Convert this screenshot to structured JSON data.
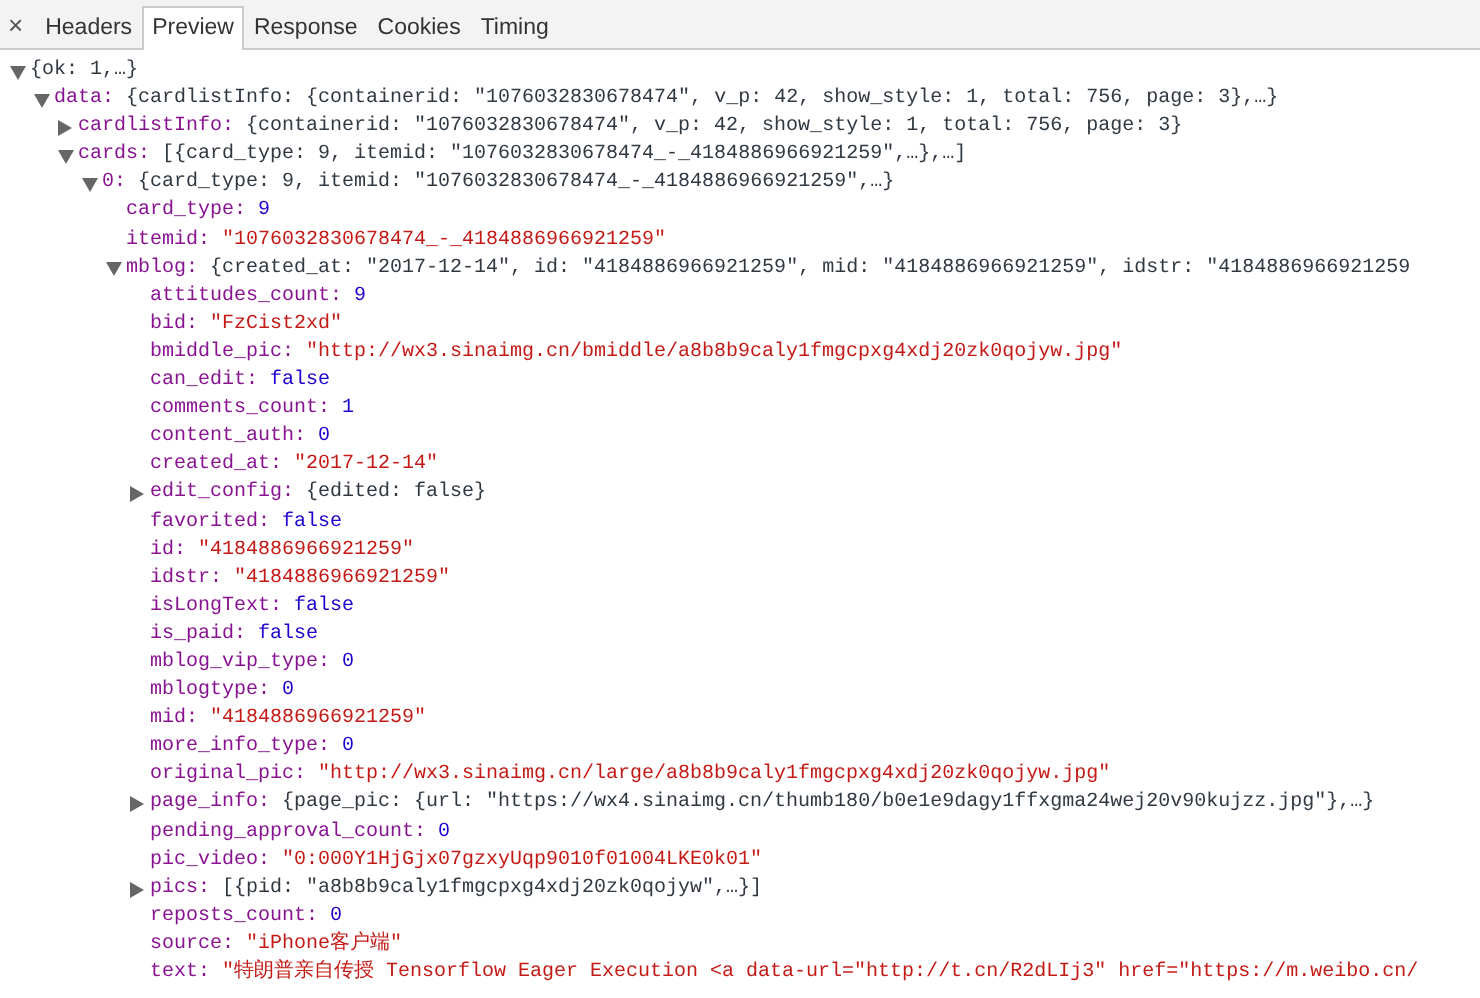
{
  "close_label": "×",
  "tabs": [
    {
      "label": "Headers",
      "selected": false
    },
    {
      "label": "Preview",
      "selected": true
    },
    {
      "label": "Response",
      "selected": false
    },
    {
      "label": "Cookies",
      "selected": false
    },
    {
      "label": "Timing",
      "selected": false
    }
  ],
  "tree": [
    {
      "value": "{ok: 1,…}",
      "kind": "preview",
      "expanded": true,
      "children": [
        {
          "key": "data:",
          "value": "{cardlistInfo: {containerid: \"1076032830678474\", v_p: 42, show_style: 1, total: 756, page: 3},…}",
          "kind": "preview",
          "expanded": true,
          "children": [
            {
              "key": "cardlistInfo:",
              "value": "{containerid: \"1076032830678474\", v_p: 42, show_style: 1, total: 756, page: 3}",
              "kind": "preview",
              "expanded": false
            },
            {
              "key": "cards:",
              "value": "[{card_type: 9, itemid: \"1076032830678474_-_4184886966921259\",…},…]",
              "kind": "preview",
              "expanded": true,
              "children": [
                {
                  "key": "0:",
                  "value": "{card_type: 9, itemid: \"1076032830678474_-_4184886966921259\",…}",
                  "kind": "preview",
                  "expanded": true,
                  "children": [
                    {
                      "key": "card_type:",
                      "value": "9",
                      "kind": "number"
                    },
                    {
                      "key": "itemid:",
                      "value": "\"1076032830678474_-_4184886966921259\"",
                      "kind": "string"
                    },
                    {
                      "key": "mblog:",
                      "value": "{created_at: \"2017-12-14\", id: \"4184886966921259\", mid: \"4184886966921259\", idstr: \"4184886966921259",
                      "kind": "preview",
                      "expanded": true,
                      "children": [
                        {
                          "key": "attitudes_count:",
                          "value": "9",
                          "kind": "number"
                        },
                        {
                          "key": "bid:",
                          "value": "\"FzCist2xd\"",
                          "kind": "string"
                        },
                        {
                          "key": "bmiddle_pic:",
                          "value": "\"http://wx3.sinaimg.cn/bmiddle/a8b8b9caly1fmgcpxg4xdj20zk0qojyw.jpg\"",
                          "kind": "string"
                        },
                        {
                          "key": "can_edit:",
                          "value": "false",
                          "kind": "boolean"
                        },
                        {
                          "key": "comments_count:",
                          "value": "1",
                          "kind": "number"
                        },
                        {
                          "key": "content_auth:",
                          "value": "0",
                          "kind": "number"
                        },
                        {
                          "key": "created_at:",
                          "value": "\"2017-12-14\"",
                          "kind": "string"
                        },
                        {
                          "key": "edit_config:",
                          "value": "{edited: false}",
                          "kind": "preview",
                          "expanded": false
                        },
                        {
                          "key": "favorited:",
                          "value": "false",
                          "kind": "boolean"
                        },
                        {
                          "key": "id:",
                          "value": "\"4184886966921259\"",
                          "kind": "string"
                        },
                        {
                          "key": "idstr:",
                          "value": "\"4184886966921259\"",
                          "kind": "string"
                        },
                        {
                          "key": "isLongText:",
                          "value": "false",
                          "kind": "boolean"
                        },
                        {
                          "key": "is_paid:",
                          "value": "false",
                          "kind": "boolean"
                        },
                        {
                          "key": "mblog_vip_type:",
                          "value": "0",
                          "kind": "number"
                        },
                        {
                          "key": "mblogtype:",
                          "value": "0",
                          "kind": "number"
                        },
                        {
                          "key": "mid:",
                          "value": "\"4184886966921259\"",
                          "kind": "string"
                        },
                        {
                          "key": "more_info_type:",
                          "value": "0",
                          "kind": "number"
                        },
                        {
                          "key": "original_pic:",
                          "value": "\"http://wx3.sinaimg.cn/large/a8b8b9caly1fmgcpxg4xdj20zk0qojyw.jpg\"",
                          "kind": "string"
                        },
                        {
                          "key": "page_info:",
                          "value": "{page_pic: {url: \"https://wx4.sinaimg.cn/thumb180/b0e1e9dagy1ffxgma24wej20v90kujzz.jpg\"},…}",
                          "kind": "preview",
                          "expanded": false
                        },
                        {
                          "key": "pending_approval_count:",
                          "value": "0",
                          "kind": "number"
                        },
                        {
                          "key": "pic_video:",
                          "value": "\"0:000Y1HjGjx07gzxyUqp9010f01004LKE0k01\"",
                          "kind": "string"
                        },
                        {
                          "key": "pics:",
                          "value": "[{pid: \"a8b8b9caly1fmgcpxg4xdj20zk0qojyw\",…}]",
                          "kind": "preview",
                          "expanded": false
                        },
                        {
                          "key": "reposts_count:",
                          "value": "0",
                          "kind": "number"
                        },
                        {
                          "key": "source:",
                          "value": "\"iPhone客户端\"",
                          "kind": "string"
                        },
                        {
                          "key": "text:",
                          "value": "\"特朗普亲自传授 Tensorflow Eager Execution <a data-url=\"http://t.cn/R2dLIj3\" href=\"https://m.weibo.cn/",
                          "kind": "string"
                        }
                      ]
                    }
                  ]
                }
              ]
            }
          ]
        }
      ]
    }
  ]
}
